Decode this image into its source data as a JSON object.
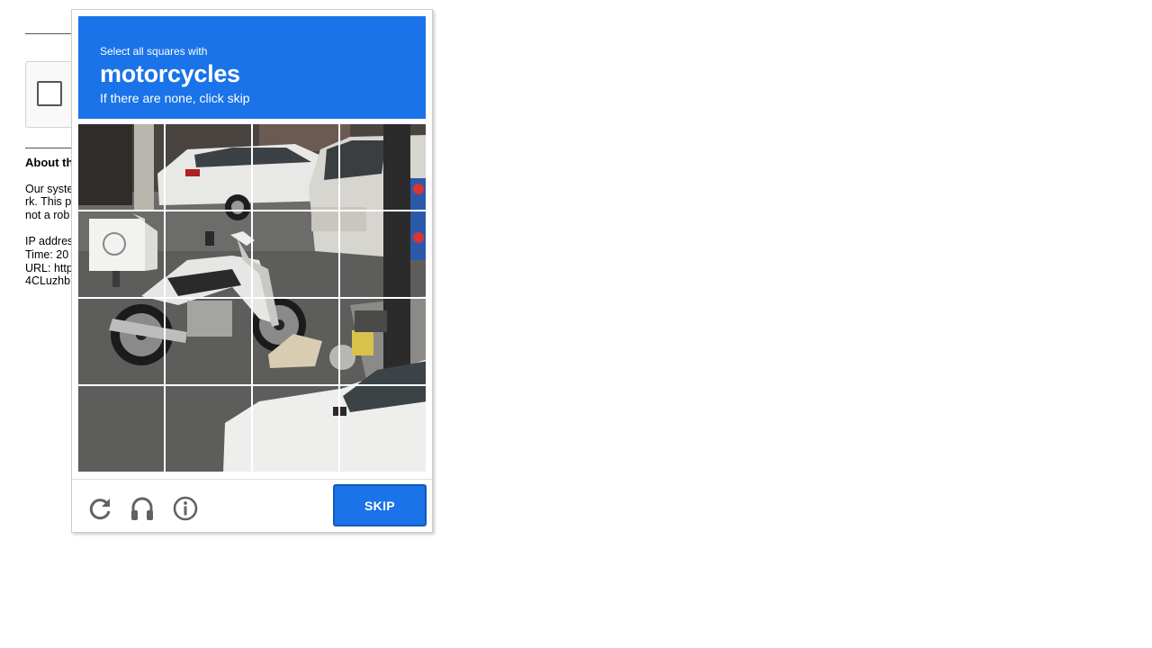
{
  "background_page": {
    "title": "About th",
    "paragraph_lines": [
      "Our syste",
      "rk. This p",
      "not a rob"
    ],
    "details_lines": [
      "IP addres",
      "Time: 20",
      "URL: http",
      "4CLuzhb"
    ]
  },
  "challenge": {
    "instruction_small": "Select all squares with",
    "target_object": "motorcycles",
    "instruction_sub": "If there are none, click skip",
    "header_color": "#1a73e8",
    "tile_count": 16,
    "grid_rows": 4,
    "grid_cols": 4,
    "skip_label": "SKIP",
    "footer_icons": [
      "reload-icon",
      "audio-headphones-icon",
      "info-icon"
    ]
  }
}
